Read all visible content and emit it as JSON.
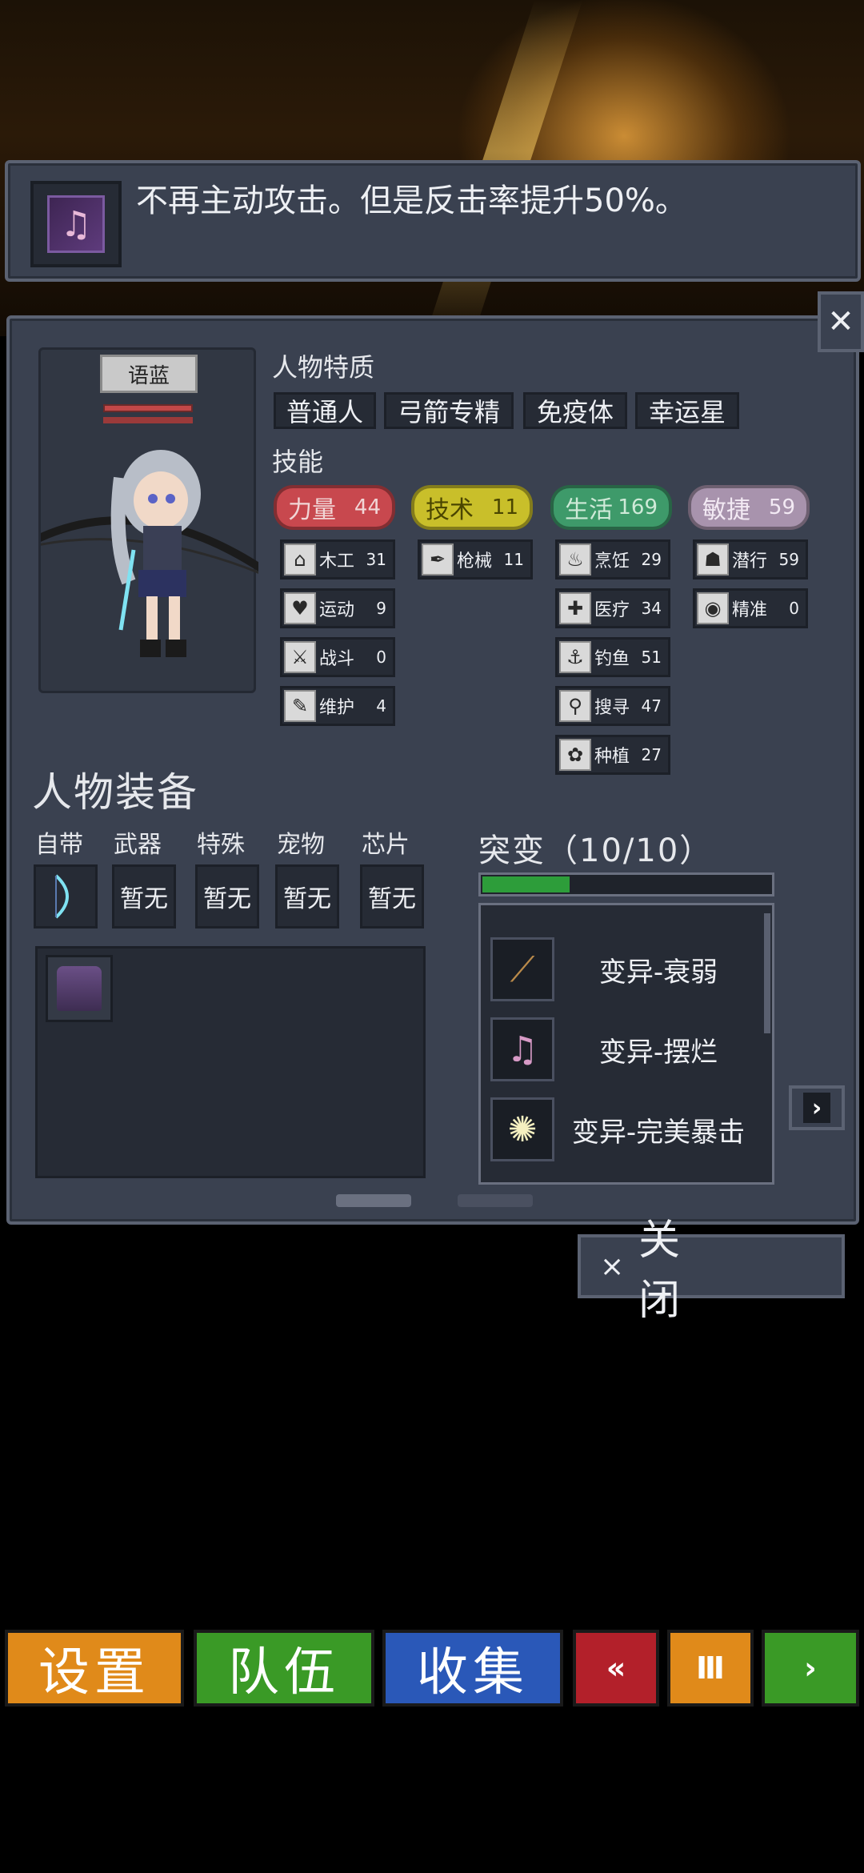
{
  "tooltip": {
    "icon": "music-note-icon",
    "text": "不再主动攻击。但是反击率提升50%。"
  },
  "character": {
    "name": "语蓝"
  },
  "traits": {
    "title": "人物特质",
    "items": [
      "普通人",
      "弓箭专精",
      "免疫体",
      "幸运星"
    ]
  },
  "skills_title": "技能",
  "stats": [
    {
      "name": "力量",
      "value": "44",
      "color": "#c8484e",
      "text_color": "#f1d6d6"
    },
    {
      "name": "技术",
      "value": "11",
      "color": "#c9bf2a",
      "text_color": "#4a4500"
    },
    {
      "name": "生活",
      "value": "169",
      "color": "#3e9a6a",
      "text_color": "#cfead8"
    },
    {
      "name": "敏捷",
      "value": "59",
      "color": "#a893ad",
      "text_color": "#f3eaf4"
    }
  ],
  "skills": {
    "col1": [
      {
        "icon": "house-icon",
        "glyph": "⌂",
        "name": "木工",
        "level": "31"
      },
      {
        "icon": "heart-icon",
        "glyph": "♥",
        "name": "运动",
        "level": "9"
      },
      {
        "icon": "wrench-icon",
        "glyph": "⚔",
        "name": "战斗",
        "level": "0"
      },
      {
        "icon": "spanner-icon",
        "glyph": "✎",
        "name": "维护",
        "level": "4"
      }
    ],
    "col2": [
      {
        "icon": "feather-icon",
        "glyph": "✒",
        "name": "枪械",
        "level": "11"
      }
    ],
    "col3": [
      {
        "icon": "pot-icon",
        "glyph": "♨",
        "name": "烹饪",
        "level": "29"
      },
      {
        "icon": "medkit-icon",
        "glyph": "✚",
        "name": "医疗",
        "level": "34"
      },
      {
        "icon": "fish-icon",
        "glyph": "⚓",
        "name": "钓鱼",
        "level": "51"
      },
      {
        "icon": "magnifier-icon",
        "glyph": "⚲",
        "name": "搜寻",
        "level": "47"
      },
      {
        "icon": "plant-icon",
        "glyph": "✿",
        "name": "种植",
        "level": "27"
      }
    ],
    "col4": [
      {
        "icon": "stealth-icon",
        "glyph": "☗",
        "name": "潜行",
        "level": "59"
      },
      {
        "icon": "eye-icon",
        "glyph": "◉",
        "name": "精准",
        "level": "0"
      }
    ]
  },
  "equipment": {
    "title": "人物装备",
    "slots": [
      {
        "label": "自带",
        "value": ""
      },
      {
        "label": "武器",
        "value": "暂无"
      },
      {
        "label": "特殊",
        "value": "暂无"
      },
      {
        "label": "宠物",
        "value": "暂无"
      },
      {
        "label": "芯片",
        "value": "暂无"
      }
    ]
  },
  "mutation": {
    "title": "突变（10/10）",
    "progress": 0.3,
    "items": [
      {
        "icon": "slash-icon",
        "glyph": "⟋",
        "name": "变异-衰弱"
      },
      {
        "icon": "music-note-icon",
        "glyph": "♫",
        "name": "变异-摆烂"
      },
      {
        "icon": "starburst-icon",
        "glyph": "✺",
        "name": "变异-完美暴击"
      }
    ]
  },
  "close_button": {
    "icon": "close-icon",
    "x": "×",
    "label": "关闭"
  },
  "close_x": "✕",
  "arrow": "›",
  "bottom_nav": [
    {
      "label": "设置",
      "color": "#e08a1a"
    },
    {
      "label": "队伍",
      "color": "#3a9a26"
    },
    {
      "label": "收集",
      "color": "#2a58b8"
    },
    {
      "label": "«",
      "color": "#b3202a"
    },
    {
      "label": "Ⅲ",
      "color": "#e08a1a"
    },
    {
      "label": "›",
      "color": "#3a9a26"
    }
  ]
}
